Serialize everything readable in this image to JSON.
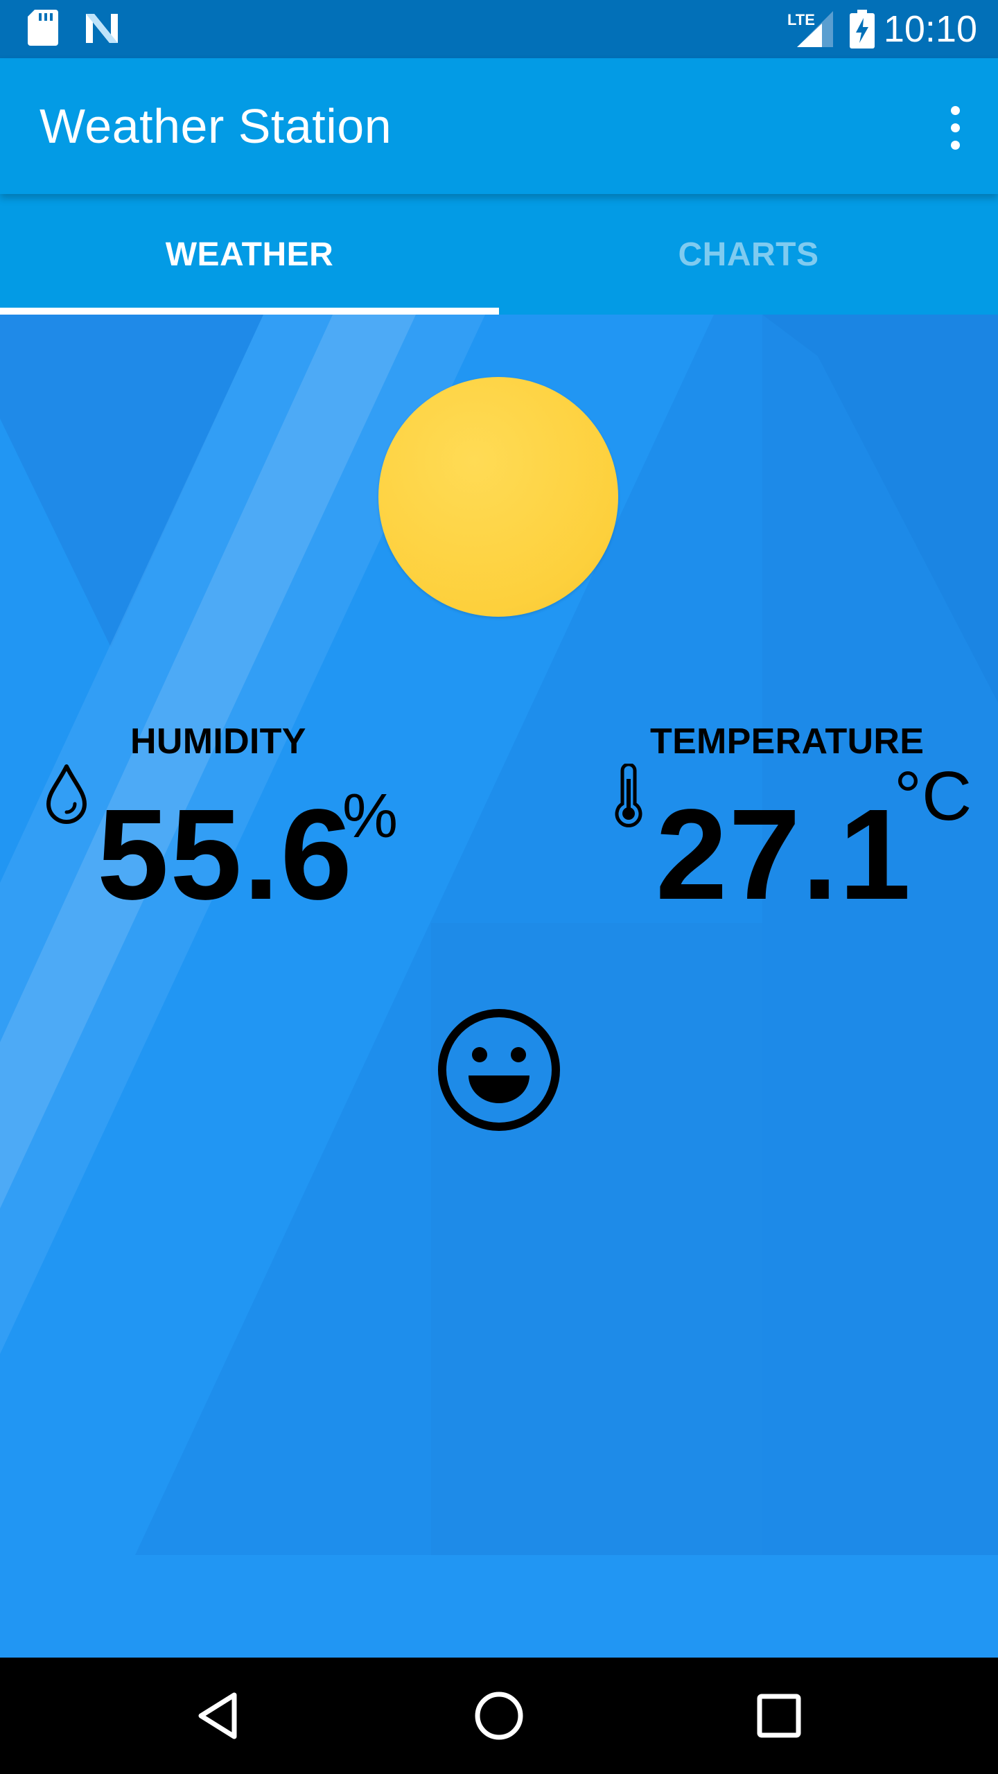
{
  "status_bar": {
    "time": "10:10",
    "network_label": "LTE",
    "icons": [
      "sd-card-icon",
      "n-logo-icon",
      "lte-signal-icon",
      "battery-charging-icon"
    ]
  },
  "app_bar": {
    "title": "Weather Station",
    "menu_icon": "more-vert-icon"
  },
  "tabs": [
    {
      "label": "WEATHER",
      "selected": true
    },
    {
      "label": "CHARTS",
      "selected": false
    }
  ],
  "weather": {
    "condition_icon": "sun-icon",
    "humidity": {
      "label": "HUMIDITY",
      "value": "55.6",
      "unit": "%",
      "icon": "water-drop-icon"
    },
    "temperature": {
      "label": "TEMPERATURE",
      "value": "27.1",
      "unit": "°C",
      "icon": "thermometer-icon"
    },
    "comfort_icon": "happy-face-icon"
  },
  "nav_bar": {
    "buttons": [
      "back-button",
      "home-button",
      "recents-button"
    ]
  },
  "colors": {
    "status_bar": "#0270b8",
    "app_bar": "#039be5",
    "content_bg": "#2196f3",
    "sun": "#fdd03c",
    "tab_inactive": "#7fcbf0"
  }
}
